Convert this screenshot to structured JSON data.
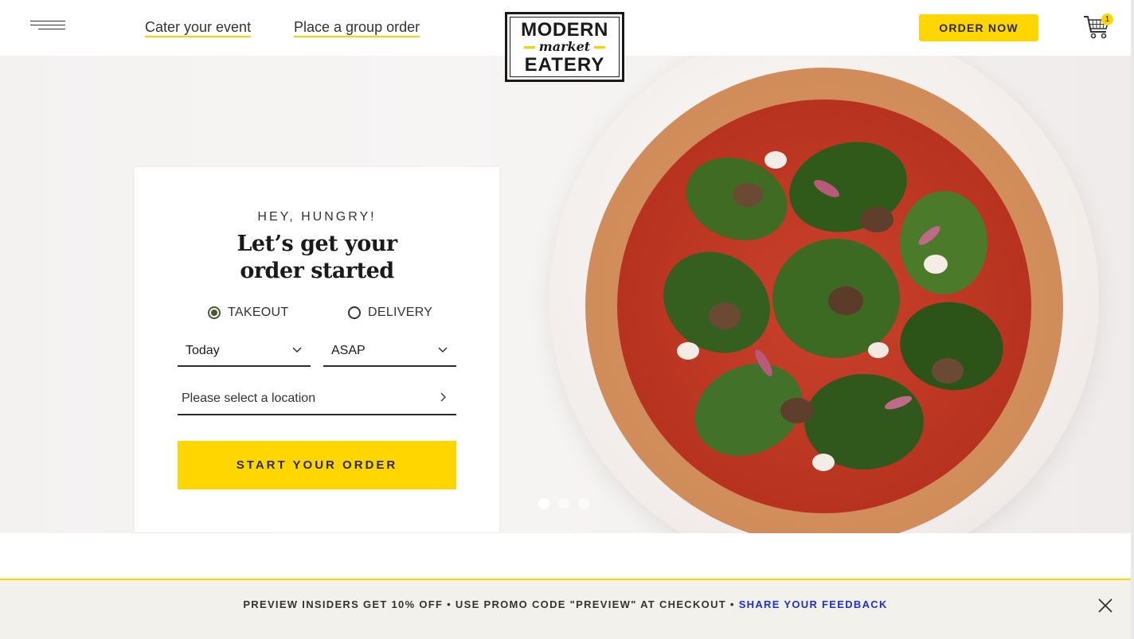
{
  "header": {
    "nav_links": [
      "Cater your event",
      "Place a group order"
    ],
    "logo": {
      "top": "MODERN",
      "middle": "market",
      "bottom": "EATERY"
    },
    "order_now_label": "ORDER NOW",
    "cart_count": "1"
  },
  "hero": {
    "carousel_dots": 3,
    "active_dot": 0
  },
  "order_card": {
    "eyebrow": "HEY, HUNGRY!",
    "headline_line1": "Let’s get your",
    "headline_line2": "order started",
    "options": [
      {
        "label": "TAKEOUT",
        "selected": true
      },
      {
        "label": "DELIVERY",
        "selected": false
      }
    ],
    "day_select": "Today",
    "time_select": "ASAP",
    "location_placeholder": "Please select a location",
    "start_button": "START YOUR ORDER"
  },
  "promo_banner": {
    "text": "PREVIEW INSIDERS GET 10% OFF • USE PROMO CODE \"PREVIEW\" AT CHECKOUT • ",
    "link": "SHARE YOUR FEEDBACK"
  },
  "colors": {
    "accent_yellow": "#ffd600",
    "link_blue": "#1d2fd8",
    "radio_green": "#4a5a2a"
  },
  "icons": [
    "menu-icon",
    "cart-icon",
    "chevron-down-icon",
    "chevron-right-icon",
    "close-icon"
  ]
}
